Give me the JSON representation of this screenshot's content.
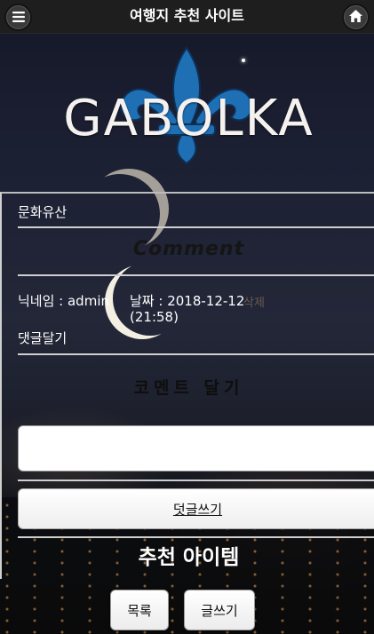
{
  "header": {
    "title": "여행지 추천 사이트",
    "menu_icon": "menu-icon",
    "home_icon": "home-icon"
  },
  "logo": {
    "text": "GABOLKA",
    "emblem": "fleur-de-lis",
    "emblem_color": "#1f6fb5"
  },
  "post": {
    "category": "문화유산",
    "comment_heading": "Comment",
    "comment_author": "닉네임 : admin",
    "comment_date": "날짜 : 2018-12-12",
    "comment_time": "(21:58)",
    "delete_link": "삭제",
    "reply_link": "댓글달기",
    "reply_heading": "코멘트 달기",
    "input_value": "",
    "submit_label": "덧글쓰기",
    "recommend_heading": "추천 아이템"
  },
  "footer": {
    "list_label": "목록",
    "write_label": "글쓰기"
  }
}
